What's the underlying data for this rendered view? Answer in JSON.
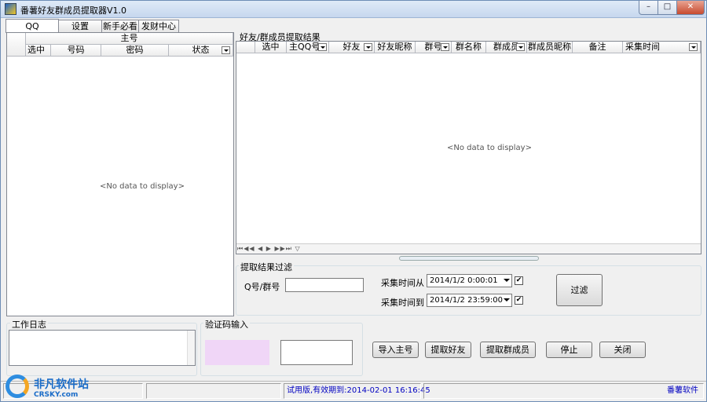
{
  "window": {
    "title": "番薯好友群成员提取器V1.0",
    "controls": {
      "minimize": "–",
      "maximize": "□",
      "close": "✕"
    }
  },
  "tabs": [
    "QQ",
    "设置",
    "新手必看",
    "发财中心"
  ],
  "left_grid": {
    "group_header": "主号",
    "columns": [
      "选中",
      "号码",
      "密码",
      "状态"
    ],
    "empty_text": "<No data to display>"
  },
  "right_grid": {
    "title": "好友/群成员提取结果",
    "columns": [
      "选中",
      "主QQ号",
      "好友",
      "好友昵称",
      "群号",
      "群名称",
      "群成员",
      "群成员昵称",
      "备注",
      "采集时间"
    ],
    "empty_text": "<No data to display>"
  },
  "filter": {
    "title": "提取结果过滤",
    "qq_label": "Q号/群号",
    "qq_value": "",
    "from_label": "采集时间从",
    "from_value": "2014/1/2 0:00:01",
    "from_checked": true,
    "to_label": "采集时间到",
    "to_value": "2014/1/2 23:59:00",
    "to_checked": true,
    "filter_button": "过滤"
  },
  "work_log": {
    "title": "工作日志"
  },
  "captcha": {
    "title": "验证码输入",
    "value": ""
  },
  "actions": {
    "import": "导入主号",
    "extract_friends": "提取好友",
    "extract_members": "提取群成员",
    "stop": "停止",
    "close": "关闭"
  },
  "status": {
    "trial": "试用版,有效期到:2014-02-01 16:16:45",
    "brand": "番薯软件"
  },
  "watermark": {
    "cn": "非凡软件站",
    "en": "CRSKY.com"
  },
  "colors": {
    "captcha_bg": "#f0d6f7",
    "status_text": "#0000c0"
  }
}
